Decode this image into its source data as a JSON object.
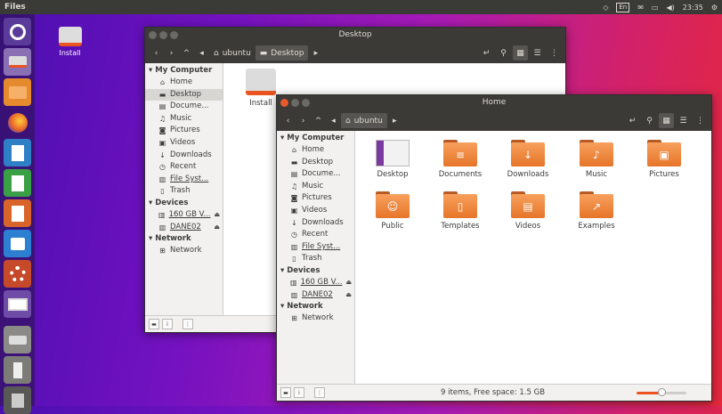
{
  "topbar": {
    "app_name": "Files",
    "keyboard": "En",
    "time": "23:35"
  },
  "desktop": {
    "install_label": "Install"
  },
  "back_window": {
    "title": "Desktop",
    "breadcrumb": {
      "home": "ubuntu",
      "current": "Desktop"
    },
    "sidebar": {
      "my_computer": "My Computer",
      "items": [
        "Home",
        "Desktop",
        "Docume...",
        "Music",
        "Pictures",
        "Videos",
        "Downloads",
        "Recent",
        "File Syst...",
        "Trash"
      ],
      "devices": "Devices",
      "device_items": [
        "160 GB V...",
        "DANE02"
      ],
      "network": "Network",
      "network_items": [
        "Network"
      ]
    },
    "file_label": "Install"
  },
  "front_window": {
    "title": "Home",
    "breadcrumb": {
      "home": "ubuntu"
    },
    "sidebar": {
      "my_computer": "My Computer",
      "items": [
        "Home",
        "Desktop",
        "Docume...",
        "Music",
        "Pictures",
        "Videos",
        "Downloads",
        "Recent",
        "File Syst...",
        "Trash"
      ],
      "devices": "Devices",
      "device_items": [
        "160 GB V...",
        "DANE02"
      ],
      "network": "Network",
      "network_items": [
        "Network"
      ]
    },
    "folders": [
      "Desktop",
      "Documents",
      "Downloads",
      "Music",
      "Pictures",
      "Public",
      "Templates",
      "Videos",
      "Examples"
    ],
    "status_text": "9 items, Free space: 1.5 GB",
    "zoom_level": 0.5
  },
  "colors": {
    "folder": "#f08b3e",
    "accent": "#e95420",
    "titlebar": "#3b3a37"
  }
}
